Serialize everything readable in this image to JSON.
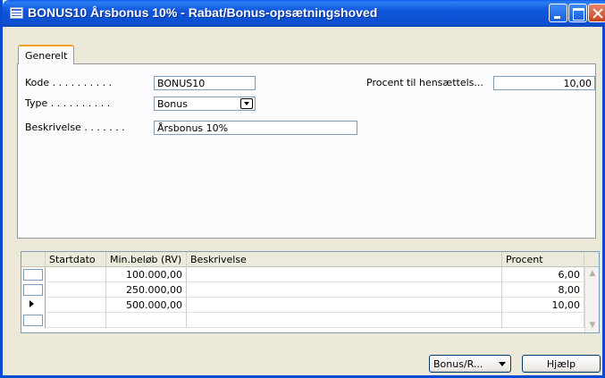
{
  "window": {
    "title": "BONUS10 Årsbonus 10% - Rabat/Bonus-opsætningshoved"
  },
  "tabs": [
    {
      "label": "Generelt",
      "active": true
    }
  ],
  "form": {
    "kode": {
      "label": "Kode . . . . . . . . . .",
      "value": "BONUS10"
    },
    "type": {
      "label": "Type . . . . . . . . . .",
      "value": "Bonus"
    },
    "beskrivelse": {
      "label": "Beskrivelse . . . . . . .",
      "value": "Årsbonus 10%"
    },
    "procent": {
      "label": "Procent til hensættels...",
      "value": "10,00"
    }
  },
  "grid": {
    "columns": [
      "Startdato",
      "Min.beløb (RV)",
      "Beskrivelse",
      "Procent"
    ],
    "rows": [
      {
        "startdato": "",
        "min_beloeb": "100.000,00",
        "beskrivelse": "",
        "procent": "6,00"
      },
      {
        "startdato": "",
        "min_beloeb": "250.000,00",
        "beskrivelse": "",
        "procent": "8,00"
      },
      {
        "startdato": "",
        "min_beloeb": "500.000,00",
        "beskrivelse": "",
        "procent": "10,00",
        "current": true
      },
      {
        "startdato": "",
        "min_beloeb": "",
        "beskrivelse": "",
        "procent": ""
      }
    ]
  },
  "buttons": {
    "bonus_menu": "Bonus/R...",
    "help": "Hjælp"
  },
  "colors": {
    "titlebar": "#0d4fd0",
    "tab_highlight": "#f0a02a",
    "window_bg": "#ece9d8"
  }
}
